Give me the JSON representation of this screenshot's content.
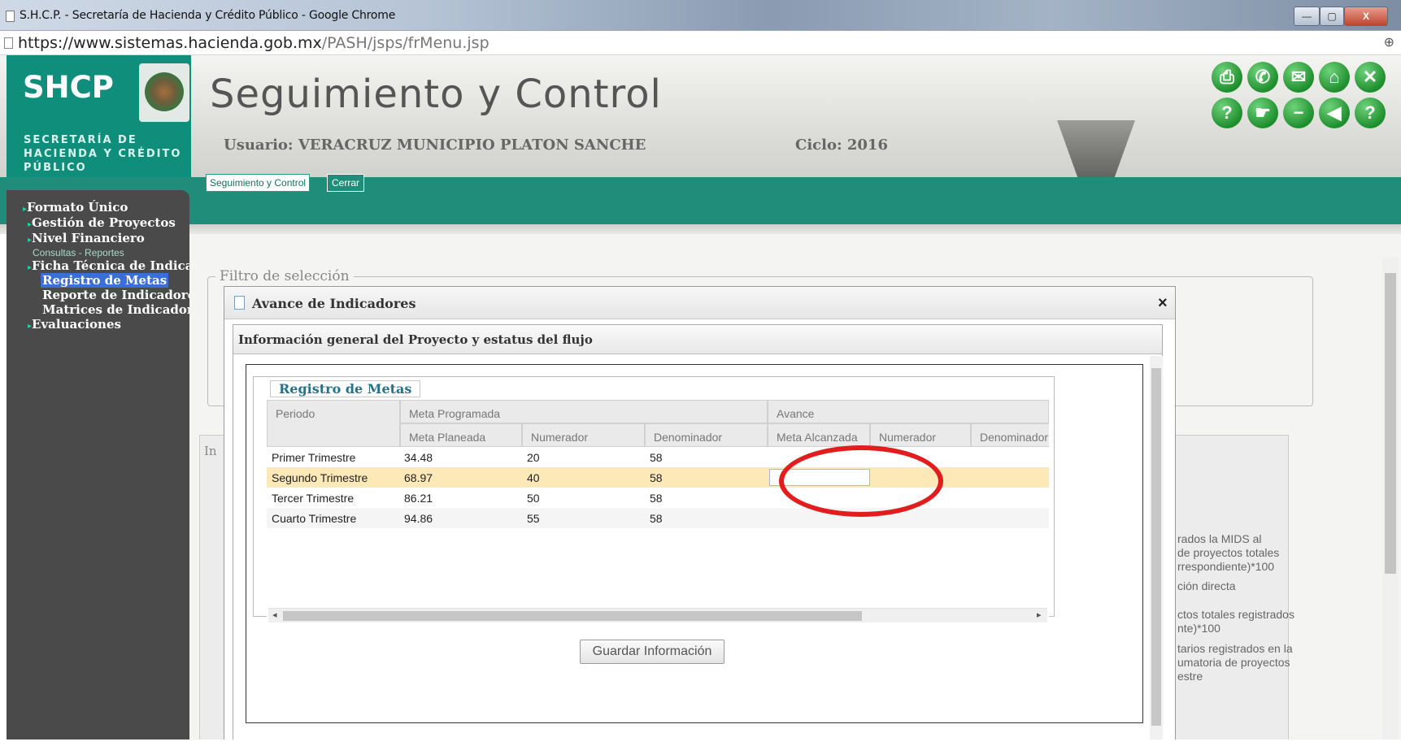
{
  "browser": {
    "window_title": "S.H.C.P. - Secretaría de Hacienda y Crédito Público - Google Chrome",
    "url_host": "https://www.sistemas.hacienda.gob.mx",
    "url_path": "/PASH/jsps/frMenu.jsp",
    "minimize": "—",
    "maximize": "▢",
    "close": "X"
  },
  "header": {
    "logo": "SHCP",
    "logo_sub": "SECRETARÍA DE HACIENDA Y CRÉDITO PÚBLICO",
    "app_title": "Seguimiento y Control",
    "user": "Usuario: VERACRUZ MUNICIPIO PLATON SANCHE",
    "ciclo": "Ciclo: 2016",
    "toolbar_icons": [
      "print-icon",
      "phone-icon",
      "mail-icon",
      "home-icon",
      "close-icon",
      "help-book-icon",
      "pointer-icon",
      "minus-icon",
      "back-icon",
      "question-icon"
    ]
  },
  "tabs": [
    {
      "label": "Seguimiento y Control"
    },
    {
      "label": "Cerrar"
    }
  ],
  "sidebar": {
    "items": [
      {
        "label": "Formato Único"
      },
      {
        "label": "Gestión de Proyectos"
      },
      {
        "label": "Nivel Financiero"
      },
      {
        "label": "Consultas - Reportes"
      },
      {
        "label": "Ficha Técnica de Indicadores"
      },
      {
        "label": "Registro de Metas"
      },
      {
        "label": "Reporte de Indicadores"
      },
      {
        "label": "Matrices de Indicadores"
      },
      {
        "label": "Evaluaciones"
      }
    ]
  },
  "background": {
    "filtro_label": "Filtro de selección",
    "panel_label": "In",
    "texts": [
      "rados la MIDS al",
      "de proyectos totales",
      "rrespondiente)*100",
      "ción directa",
      "ctos totales registrados",
      "nte)*100",
      "tarios registrados en la",
      "umatoria de proyectos",
      "estre"
    ]
  },
  "modal": {
    "title": "Avance de Indicadores",
    "close": "×",
    "section_title": "Información general del Proyecto y estatus del flujo",
    "legend": "Registro de Metas",
    "table": {
      "group_headers": [
        "Periodo",
        "Meta Programada",
        "Avance"
      ],
      "sub_headers": [
        "Meta Planeada",
        "Numerador",
        "Denominador",
        "Meta Alcanzada",
        "Numerador",
        "Denominador"
      ],
      "rows": [
        {
          "periodo": "Primer Trimestre",
          "meta_planeada": "34.48",
          "numerador": "20",
          "denominador": "58"
        },
        {
          "periodo": "Segundo Trimestre",
          "meta_planeada": "68.97",
          "numerador": "40",
          "denominador": "58"
        },
        {
          "periodo": "Tercer Trimestre",
          "meta_planeada": "86.21",
          "numerador": "50",
          "denominador": "58"
        },
        {
          "periodo": "Cuarto Trimestre",
          "meta_planeada": "94.86",
          "numerador": "55",
          "denominador": "58"
        }
      ],
      "meta_alcanzada_value": ""
    },
    "save_button": "Guardar Información"
  }
}
